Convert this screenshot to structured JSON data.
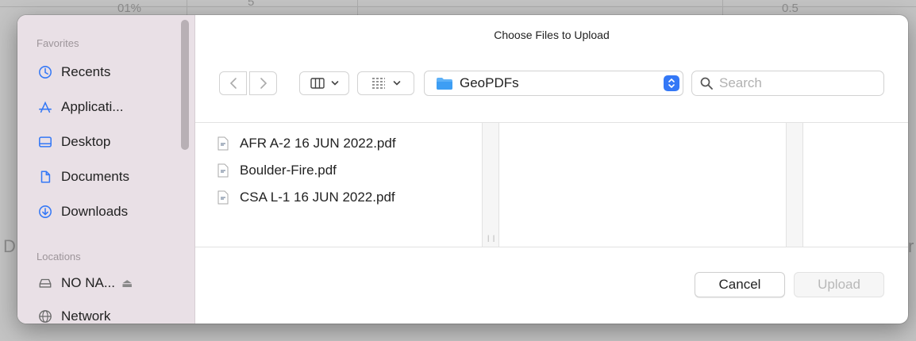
{
  "dialog": {
    "title": "Choose Files to Upload"
  },
  "sidebar": {
    "favorites_heading": "Favorites",
    "favorites": [
      {
        "label": "Recents",
        "icon": "clock-icon"
      },
      {
        "label": "Applicati...",
        "icon": "applications-icon"
      },
      {
        "label": "Desktop",
        "icon": "desktop-icon"
      },
      {
        "label": "Documents",
        "icon": "document-icon"
      },
      {
        "label": "Downloads",
        "icon": "download-icon"
      }
    ],
    "locations_heading": "Locations",
    "locations": [
      {
        "label": "NO NA...",
        "icon": "drive-icon"
      },
      {
        "label": "Network",
        "icon": "network-icon"
      }
    ]
  },
  "toolbar": {
    "current_folder": "GeoPDFs",
    "search_placeholder": "Search"
  },
  "files": [
    {
      "name": "AFR A-2 16 JUN 2022.pdf"
    },
    {
      "name": "Boulder-Fire.pdf"
    },
    {
      "name": "CSA L-1 16 JUN 2022.pdf"
    }
  ],
  "buttons": {
    "cancel": "Cancel",
    "upload": "Upload"
  },
  "background": {
    "top_left_text": "01%",
    "top_mid_text": "5",
    "top_right_text": "0.5",
    "left_letter": "D",
    "right_letter": "r"
  },
  "colors": {
    "accent": "#3478f6",
    "sidebar_bg": "#e9e0e6"
  }
}
